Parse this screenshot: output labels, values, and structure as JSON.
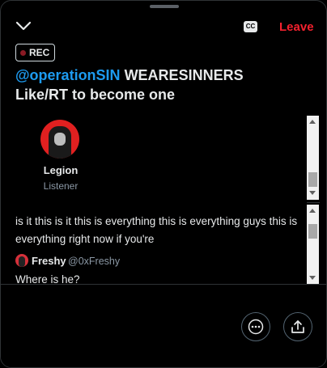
{
  "header": {
    "leave_label": "Leave",
    "cc_label": "CC",
    "minimize_icon": "chevron-down-icon"
  },
  "rec_badge": "REC",
  "space_title": {
    "mention": "@operationSIN",
    "rest_line1": " WEARESINNERS",
    "line2": "Like/RT to become one"
  },
  "participant": {
    "name": "Legion",
    "role": "Listener"
  },
  "caption": {
    "text": "is it this is it this is everything this is everything guys this is everything right now if you're"
  },
  "comment": {
    "author": "Freshy",
    "handle": "@0xFreshy",
    "text": "Where is he?"
  },
  "controls": {
    "more_icon": "more-icon",
    "share_icon": "share-icon"
  },
  "colors": {
    "accent": "#1d9bf0",
    "leave": "#f4212e",
    "background": "#000000"
  }
}
